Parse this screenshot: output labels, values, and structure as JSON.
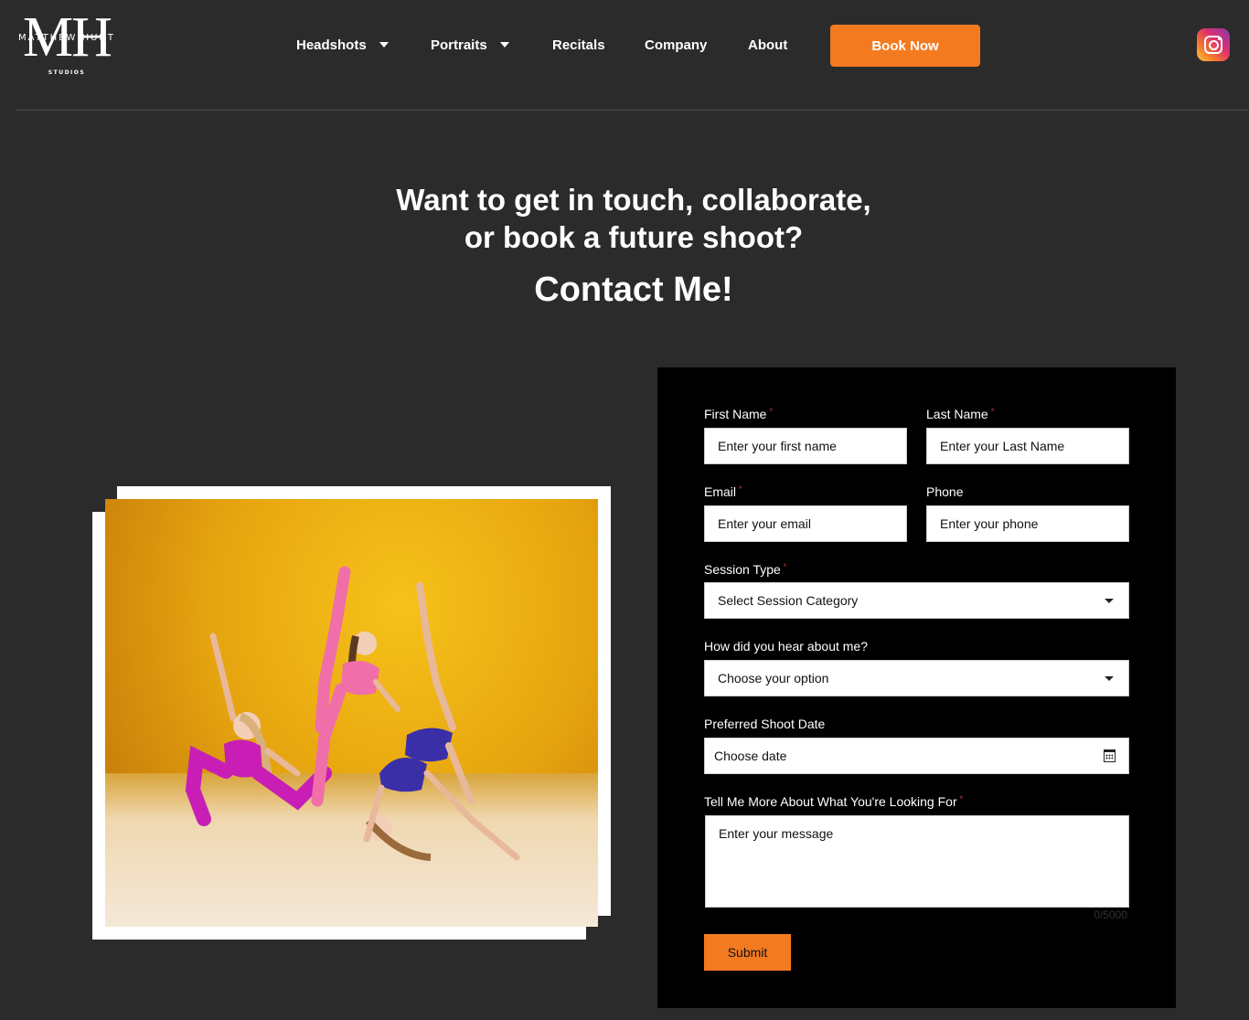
{
  "brand": {
    "logo_letters": "MH",
    "logo_name": "MATTHEW HUNT",
    "logo_sub": "STUDIOS"
  },
  "nav": {
    "headshots": "Headshots",
    "portraits": "Portraits",
    "recitals": "Recitals",
    "company": "Company",
    "about": "About",
    "book_now": "Book Now"
  },
  "hero": {
    "headline_line1": "Want to get in touch, collaborate,",
    "headline_line2": "or book a future shoot?",
    "contact": "Contact Me!"
  },
  "form": {
    "first_name": {
      "label": "First Name",
      "placeholder": "Enter your first name"
    },
    "last_name": {
      "label": "Last Name",
      "placeholder": "Enter your Last Name"
    },
    "email": {
      "label": "Email",
      "placeholder": "Enter your email"
    },
    "phone": {
      "label": "Phone",
      "placeholder": "Enter your phone"
    },
    "session_type": {
      "label": "Session Type",
      "value": "Select Session Category"
    },
    "heard_about": {
      "label": "How did you hear about me?",
      "value": "Choose your option"
    },
    "shoot_date": {
      "label": "Preferred Shoot Date",
      "value": "Choose date"
    },
    "message": {
      "label": "Tell Me More About What You're Looking For",
      "placeholder": "Enter your message",
      "counter": "0/5000"
    },
    "required_mark": "*",
    "submit": "Submit"
  },
  "colors": {
    "background": "#2b2b2b",
    "accent": "#f47a20",
    "form_panel": "#000000"
  }
}
